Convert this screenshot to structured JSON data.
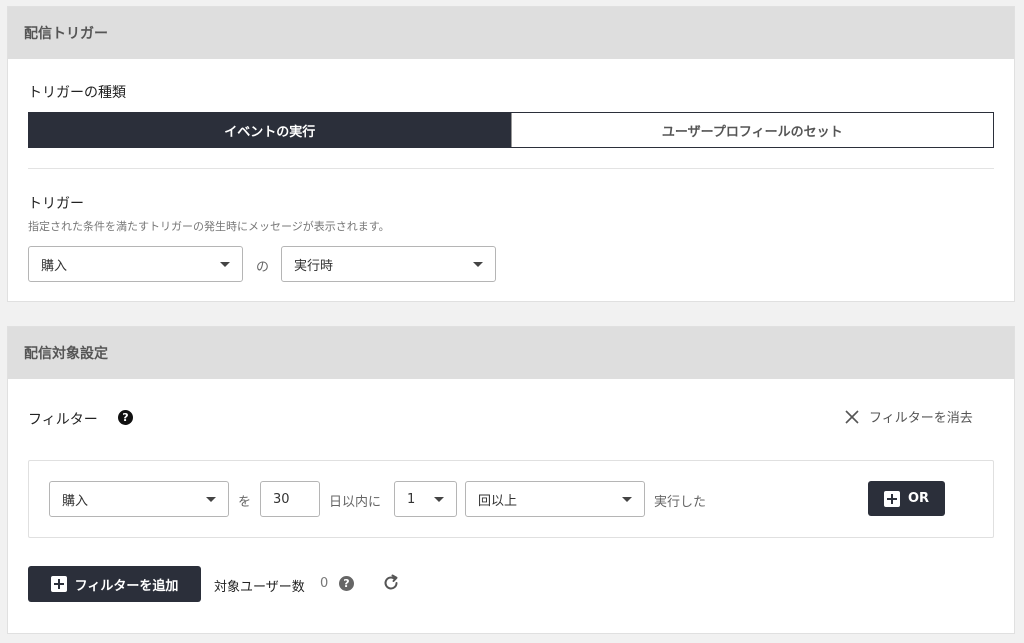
{
  "trigger_section": {
    "title": "配信トリガー",
    "type_label": "トリガーの種類",
    "type_options": [
      "イベントの実行",
      "ユーザープロフィールのセット"
    ],
    "trigger_label": "トリガー",
    "trigger_description": "指定された条件を満たすトリガーの発生時にメッセージが表示されます。",
    "event_select": "購入",
    "connector": "の",
    "timing_select": "実行時"
  },
  "target_section": {
    "title": "配信対象設定",
    "filter_label": "フィルター",
    "clear_label": "フィルターを消去",
    "filter_row": {
      "event_select": "購入",
      "connector_wo": "を",
      "days_value": "30",
      "days_label": "日以内に",
      "count_select": "1",
      "count_mode_select": "回以上",
      "action_label": "実行した",
      "or_label": "OR"
    },
    "add_filter_label": "フィルターを追加",
    "target_users_label": "対象ユーザー数",
    "target_users_count": "0"
  },
  "colors": {
    "dark": "#2b2f3a",
    "header_bg": "#dedede",
    "page_bg": "#f1f1f1"
  },
  "icons": {
    "help": "help-circle-icon",
    "close": "close-icon",
    "refresh": "refresh-icon",
    "plus": "plus-square-icon",
    "caret": "caret-down-icon"
  }
}
